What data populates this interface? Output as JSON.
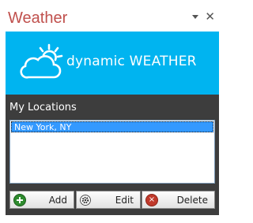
{
  "pane": {
    "title": "Weather",
    "close_glyph": "✕"
  },
  "banner": {
    "brand_text": "dynamic WEATHER",
    "icon": "cloud-sun-icon",
    "color": "#00b4f0"
  },
  "locations": {
    "label": "My Locations",
    "items": [
      "New York, NY"
    ],
    "selected_index": 0
  },
  "buttons": {
    "add_label": "Add",
    "edit_label": "Edit",
    "delete_label": "Delete"
  },
  "colors": {
    "title": "#c0504d",
    "panel": "#3d3d3d",
    "selection": "#3399ff"
  }
}
